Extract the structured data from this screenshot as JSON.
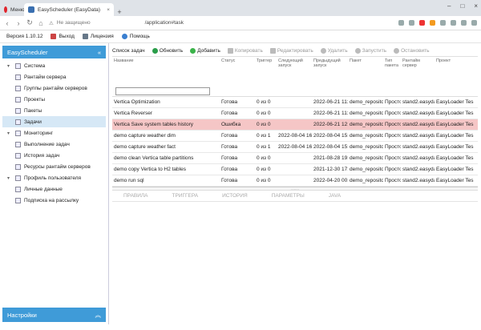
{
  "browser": {
    "menu_tab": "Меню",
    "active_tab": "EasyScheduler (EasyData)",
    "close": "×",
    "new_tab": "+",
    "security": "Не защищено",
    "url": "/application#task"
  },
  "appbar": {
    "version": "Версия 1.10.12",
    "exit": "Выход",
    "license": "Лицензия",
    "help": "Помощь"
  },
  "sidebar": {
    "title": "EasyScheduler",
    "footer": "Настройки",
    "groups": [
      {
        "label": "Система",
        "items": [
          "Рантайм сервера",
          "Группы рантайм серверов",
          "Проекты",
          "Пакеты",
          "Задачи"
        ]
      },
      {
        "label": "Мониторинг",
        "items": [
          "Выполнение задач",
          "История задач",
          "Ресурсы рантайм серверов"
        ]
      },
      {
        "label": "Профиль пользователя",
        "items": [
          "Личные данные",
          "Подписка на рассылку"
        ]
      }
    ]
  },
  "toolbar": {
    "title": "Список задач",
    "refresh": "Обновить",
    "add": "Добавить",
    "copy": "Копировать",
    "edit": "Редактировать",
    "delete": "Удалить",
    "start": "Запустить",
    "stop": "Остановить"
  },
  "grid": {
    "headers": [
      "Название",
      "Статус",
      "Триггер",
      "Следующий запуск",
      "Предыдущий запуск",
      "Пакет",
      "Тип пакета",
      "Рантайм сервер",
      "Проект"
    ],
    "rows": [
      [
        "Vertica Optimization",
        "Готова",
        "0 из 0",
        "",
        "2022-06-21 11:5",
        "demo_repositor",
        "Просто",
        "stand2.easydat",
        "EasyLoader Tes"
      ],
      [
        "Vertica Reverser",
        "Готова",
        "0 из 0",
        "",
        "2022-06-21 11:5",
        "demo_repositor",
        "Просто",
        "stand2.easydat",
        "EasyLoader Tes"
      ],
      [
        "Vertica Save system tables history",
        "Ошибка",
        "0 из 0",
        "",
        "2022-06-21 12:",
        "demo_repositor",
        "Просто",
        "stand2.easydat",
        "EasyLoader Tes"
      ],
      [
        "demo capture weather dim",
        "Готова",
        "0 из 1",
        "2022-08-04 16:",
        "2022-08-04 15:",
        "demo_repositor",
        "Просто",
        "stand2.easydat",
        "EasyLoader Tes"
      ],
      [
        "demo capture weather fact",
        "Готова",
        "0 из 1",
        "2022-08-04 16:",
        "2022-08-04 15:",
        "demo_repositor",
        "Просто",
        "stand2.easydat",
        "EasyLoader Tes"
      ],
      [
        "demo clean Vertica table partitions",
        "Готова",
        "0 из 0",
        "",
        "2021-08-28 19:",
        "demo_repositor",
        "Просто",
        "stand2.easydat",
        "EasyLoader Tes"
      ],
      [
        "demo copy Vertica to H2 tables",
        "Готова",
        "0 из 0",
        "",
        "2021-12-30 17:",
        "demo_repositor",
        "Просто",
        "stand2.easydat",
        "EasyLoader Tes"
      ],
      [
        "demo run sql",
        "Готова",
        "0 из 0",
        "",
        "2022-04-20 00:",
        "demo_repositor",
        "Просто",
        "stand2.easydat",
        "EasyLoader Tes"
      ]
    ],
    "error_color": "#f5c6c6"
  },
  "detail_tabs": [
    "ПРАВИЛА",
    "ТРИГГЕРА",
    "ИСТОРИЯ",
    "ПАРАМЕТРЫ",
    "JAVA"
  ]
}
